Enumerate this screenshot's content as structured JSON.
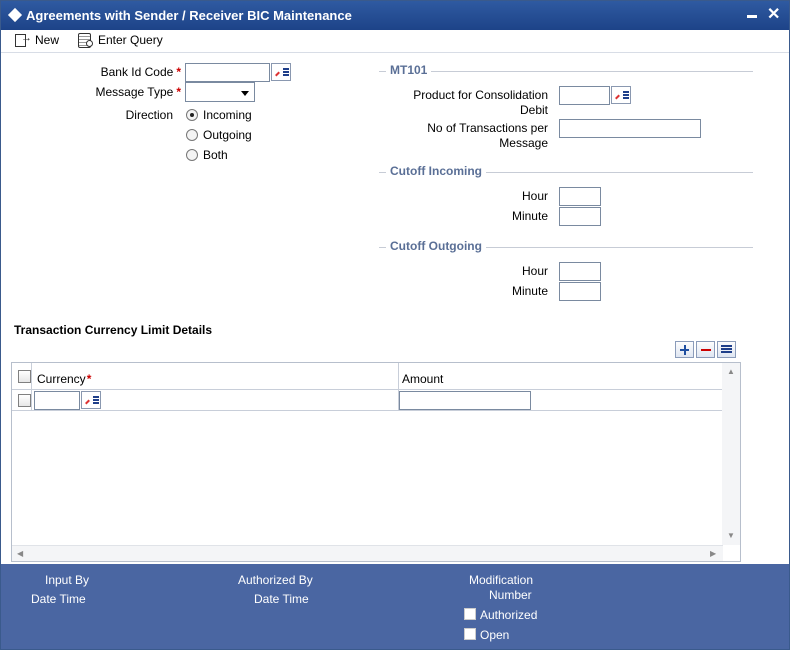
{
  "window": {
    "title": "Agreements with Sender / Receiver BIC Maintenance",
    "minimize_icon": "minimize-icon",
    "close_glyph": "✕"
  },
  "toolbar": {
    "new_label": "New",
    "enter_query_label": "Enter Query"
  },
  "form": {
    "bank_id_code_label": "Bank Id Code",
    "bank_id_code_value": "",
    "message_type_label": "Message Type",
    "message_type_value": "",
    "direction_label": "Direction",
    "direction_options": [
      "Incoming",
      "Outgoing",
      "Both"
    ],
    "direction_selected": "Incoming",
    "required_marker": "*"
  },
  "mt101": {
    "section_title": "MT101",
    "product_label_line1": "Product for Consolidation",
    "product_label_line2": "Debit",
    "product_value": "",
    "no_txn_label_line1": "No of Transactions per",
    "no_txn_label_line2": "Message",
    "no_txn_value": ""
  },
  "cutoff_incoming": {
    "section_title": "Cutoff Incoming",
    "hour_label": "Hour",
    "hour_value": "",
    "minute_label": "Minute",
    "minute_value": ""
  },
  "cutoff_outgoing": {
    "section_title": "Cutoff Outgoing",
    "hour_label": "Hour",
    "hour_value": "",
    "minute_label": "Minute",
    "minute_value": ""
  },
  "grid": {
    "title": "Transaction Currency Limit Details",
    "columns": [
      "Currency",
      "Amount"
    ],
    "rows": [
      {
        "currency": "",
        "amount": ""
      }
    ]
  },
  "footer": {
    "input_by_label": "Input By",
    "date_time_label_1": "Date Time",
    "authorized_by_label": "Authorized By",
    "date_time_label_2": "Date Time",
    "modification_label": "Modification",
    "number_label": "Number",
    "authorized_chk_label": "Authorized",
    "open_chk_label": "Open"
  },
  "colors": {
    "titlebar": "#2f5aa1",
    "footer": "#4a66a2",
    "section_title": "#5a6f96",
    "required": "#cc0000"
  }
}
